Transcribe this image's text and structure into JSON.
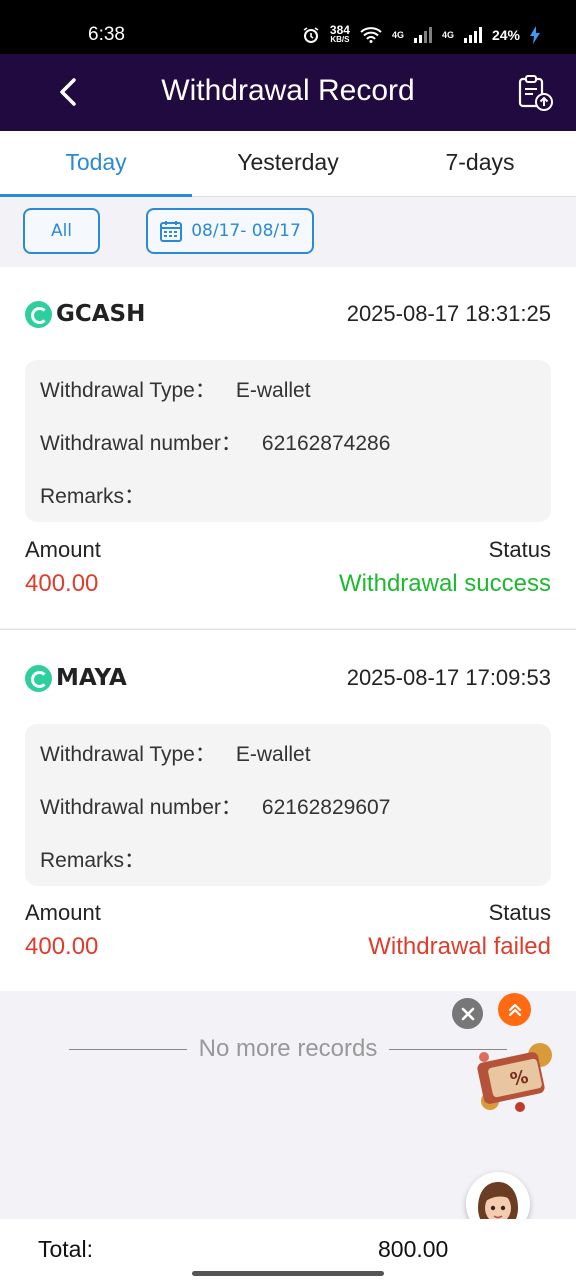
{
  "status_bar": {
    "time": "6:38",
    "net_speed": "384",
    "net_unit": "KB/S",
    "net_type_1": "4G",
    "net_type_2": "4G",
    "battery": "24%"
  },
  "header": {
    "title": "Withdrawal Record",
    "back_icon": "chevron-left-icon",
    "upload_icon": "clipboard-upload-icon"
  },
  "tabs": [
    {
      "label": "Today",
      "active": true
    },
    {
      "label": "Yesterday",
      "active": false
    },
    {
      "label": "7-days",
      "active": false
    }
  ],
  "filters": {
    "type_label": "All",
    "date_range": "08/17- 08/17",
    "date_icon": "calendar-icon"
  },
  "records": [
    {
      "channel": "GCASH",
      "datetime": "2025-08-17 18:31:25",
      "type_label": "Withdrawal Type：",
      "type_value": "E-wallet",
      "number_label": "Withdrawal number：",
      "number_value": "62162874286",
      "remarks_label": "Remarks：",
      "amount_label": "Amount",
      "amount": "400.00",
      "status_label": "Status",
      "status": "Withdrawal success"
    },
    {
      "channel": "MAYA",
      "datetime": "2025-08-17 17:09:53",
      "type_label": "Withdrawal Type：",
      "type_value": "E-wallet",
      "number_label": "Withdrawal number：",
      "number_value": "62162829607",
      "remarks_label": "Remarks：",
      "amount_label": "Amount",
      "amount": "400.00",
      "status_label": "Status",
      "status": "Withdrawal failed"
    }
  ],
  "no_more_text": "No more records",
  "footer": {
    "total_label": "Total:",
    "total_value": "800.00"
  },
  "colors": {
    "header_bg": "#210a3f",
    "accent": "#2b8ad6",
    "amount": "#e03c2c",
    "success": "#1db92f",
    "failed": "#e03c2c"
  }
}
